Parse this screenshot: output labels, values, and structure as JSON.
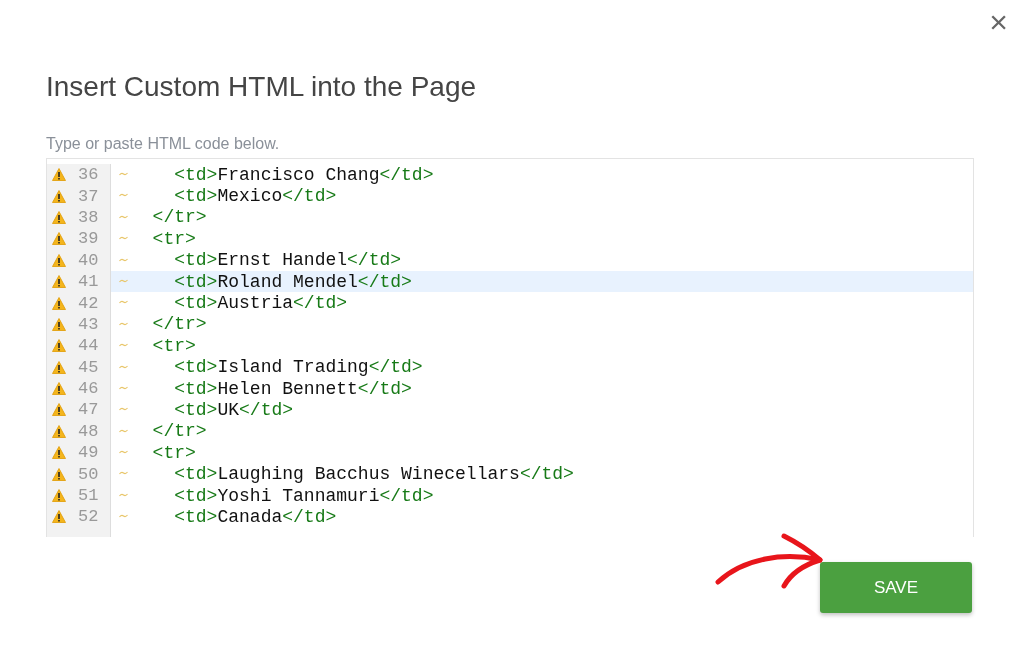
{
  "dialog": {
    "title": "Insert Custom HTML into the Page",
    "close": "×",
    "hint": "Type or paste HTML code below."
  },
  "editor": {
    "lines": [
      {
        "number": "36",
        "warning": true,
        "active": false,
        "parts": [
          {
            "kind": "tag",
            "text": "    <td>"
          },
          {
            "kind": "text",
            "text": "Francisco Chang"
          },
          {
            "kind": "tag",
            "text": "</td>"
          }
        ]
      },
      {
        "number": "37",
        "warning": true,
        "active": false,
        "parts": [
          {
            "kind": "tag",
            "text": "    <td>"
          },
          {
            "kind": "text",
            "text": "Mexico"
          },
          {
            "kind": "tag",
            "text": "</td>"
          }
        ]
      },
      {
        "number": "38",
        "warning": true,
        "active": false,
        "parts": [
          {
            "kind": "tag",
            "text": "  </tr>"
          }
        ]
      },
      {
        "number": "39",
        "warning": true,
        "active": false,
        "parts": [
          {
            "kind": "tag",
            "text": "  <tr>"
          }
        ]
      },
      {
        "number": "40",
        "warning": true,
        "active": false,
        "parts": [
          {
            "kind": "tag",
            "text": "    <td>"
          },
          {
            "kind": "text",
            "text": "Ernst Handel"
          },
          {
            "kind": "tag",
            "text": "</td>"
          }
        ]
      },
      {
        "number": "41",
        "warning": true,
        "active": true,
        "parts": [
          {
            "kind": "tag",
            "text": "    <td>"
          },
          {
            "kind": "text",
            "text": "Roland Mendel"
          },
          {
            "kind": "tag",
            "text": "</td>"
          }
        ]
      },
      {
        "number": "42",
        "warning": true,
        "active": false,
        "parts": [
          {
            "kind": "tag",
            "text": "    <td>"
          },
          {
            "kind": "text",
            "text": "Austria"
          },
          {
            "kind": "tag",
            "text": "</td>"
          }
        ]
      },
      {
        "number": "43",
        "warning": true,
        "active": false,
        "parts": [
          {
            "kind": "tag",
            "text": "  </tr>"
          }
        ]
      },
      {
        "number": "44",
        "warning": true,
        "active": false,
        "parts": [
          {
            "kind": "tag",
            "text": "  <tr>"
          }
        ]
      },
      {
        "number": "45",
        "warning": true,
        "active": false,
        "parts": [
          {
            "kind": "tag",
            "text": "    <td>"
          },
          {
            "kind": "text",
            "text": "Island Trading"
          },
          {
            "kind": "tag",
            "text": "</td>"
          }
        ]
      },
      {
        "number": "46",
        "warning": true,
        "active": false,
        "parts": [
          {
            "kind": "tag",
            "text": "    <td>"
          },
          {
            "kind": "text",
            "text": "Helen Bennett"
          },
          {
            "kind": "tag",
            "text": "</td>"
          }
        ]
      },
      {
        "number": "47",
        "warning": true,
        "active": false,
        "parts": [
          {
            "kind": "tag",
            "text": "    <td>"
          },
          {
            "kind": "text",
            "text": "UK"
          },
          {
            "kind": "tag",
            "text": "</td>"
          }
        ]
      },
      {
        "number": "48",
        "warning": true,
        "active": false,
        "parts": [
          {
            "kind": "tag",
            "text": "  </tr>"
          }
        ]
      },
      {
        "number": "49",
        "warning": true,
        "active": false,
        "parts": [
          {
            "kind": "tag",
            "text": "  <tr>"
          }
        ]
      },
      {
        "number": "50",
        "warning": true,
        "active": false,
        "parts": [
          {
            "kind": "tag",
            "text": "    <td>"
          },
          {
            "kind": "text",
            "text": "Laughing Bacchus Winecellars"
          },
          {
            "kind": "tag",
            "text": "</td>"
          }
        ]
      },
      {
        "number": "51",
        "warning": true,
        "active": false,
        "parts": [
          {
            "kind": "tag",
            "text": "    <td>"
          },
          {
            "kind": "text",
            "text": "Yoshi Tannamuri"
          },
          {
            "kind": "tag",
            "text": "</td>"
          }
        ]
      },
      {
        "number": "52",
        "warning": true,
        "active": false,
        "parts": [
          {
            "kind": "tag",
            "text": "    <td>"
          },
          {
            "kind": "text",
            "text": "Canada"
          },
          {
            "kind": "tag",
            "text": "</td>"
          }
        ]
      }
    ]
  },
  "save_button": "SAVE"
}
